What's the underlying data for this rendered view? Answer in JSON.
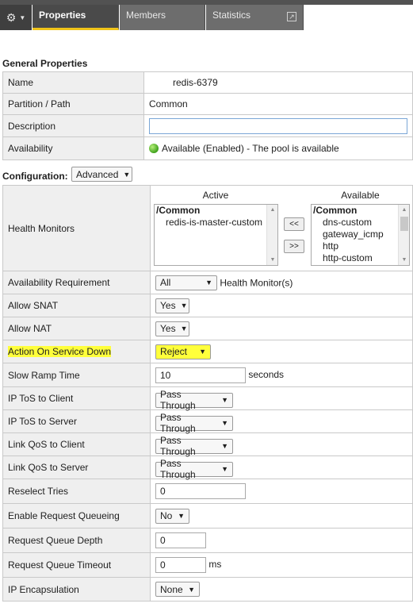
{
  "tabs": [
    {
      "label": "Properties",
      "active": true
    },
    {
      "label": "Members",
      "active": false
    },
    {
      "label": "Statistics",
      "active": false
    }
  ],
  "general": {
    "title": "General Properties",
    "name": {
      "label": "Name",
      "value": "redis-6379"
    },
    "partition": {
      "label": "Partition / Path",
      "value": "Common"
    },
    "description": {
      "label": "Description",
      "value": ""
    },
    "availability": {
      "label": "Availability",
      "value": "Available (Enabled) - The pool is available"
    }
  },
  "configuration": {
    "title": "Configuration:",
    "mode": "Advanced",
    "health_monitors": {
      "label": "Health Monitors",
      "active_header": "Active",
      "available_header": "Available",
      "active_folder": "/Common",
      "active_items": [
        "redis-is-master-custom"
      ],
      "available_folder": "/Common",
      "available_items": [
        "dns-custom",
        "gateway_icmp",
        "http",
        "http-custom"
      ],
      "move_left": "<<",
      "move_right": ">>"
    },
    "availability_requirement": {
      "label": "Availability Requirement",
      "value": "All",
      "suffix": "Health Monitor(s)"
    },
    "allow_snat": {
      "label": "Allow SNAT",
      "value": "Yes"
    },
    "allow_nat": {
      "label": "Allow NAT",
      "value": "Yes"
    },
    "action_on_service_down": {
      "label": "Action On Service Down",
      "value": "Reject"
    },
    "slow_ramp_time": {
      "label": "Slow Ramp Time",
      "value": "10",
      "unit": "seconds"
    },
    "ip_tos_client": {
      "label": "IP ToS to Client",
      "value": "Pass Through"
    },
    "ip_tos_server": {
      "label": "IP ToS to Server",
      "value": "Pass Through"
    },
    "link_qos_client": {
      "label": "Link QoS to Client",
      "value": "Pass Through"
    },
    "link_qos_server": {
      "label": "Link QoS to Server",
      "value": "Pass Through"
    },
    "reselect_tries": {
      "label": "Reselect Tries",
      "value": "0"
    },
    "enable_request_queueing": {
      "label": "Enable Request Queueing",
      "value": "No"
    },
    "request_queue_depth": {
      "label": "Request Queue Depth",
      "value": "0"
    },
    "request_queue_timeout": {
      "label": "Request Queue Timeout",
      "value": "0",
      "unit": "ms"
    },
    "ip_encapsulation": {
      "label": "IP Encapsulation",
      "value": "None"
    }
  },
  "colors": {
    "tab_accent": "#f0c419",
    "highlight": "#ffff3b",
    "status_green": "#3fa11c"
  }
}
